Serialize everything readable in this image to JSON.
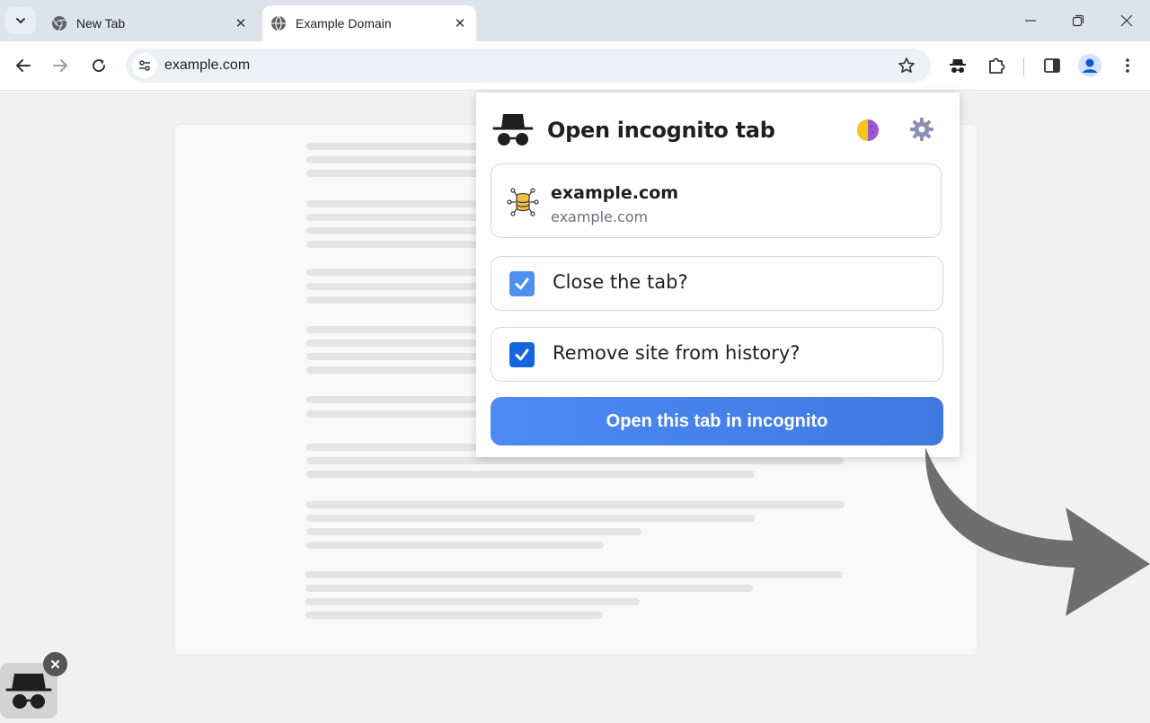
{
  "browser": {
    "tabs": [
      {
        "title": "New Tab",
        "favicon": "chrome-icon",
        "active": false
      },
      {
        "title": "Example Domain",
        "favicon": "globe-icon",
        "active": true
      }
    ],
    "address_bar": {
      "url": "example.com"
    }
  },
  "popup": {
    "title": "Open incognito tab",
    "site": {
      "name": "example.com",
      "url": "example.com"
    },
    "options": [
      {
        "label": "Close the tab?",
        "checked": true
      },
      {
        "label": "Remove site from history?",
        "checked": true
      }
    ],
    "cta_label": "Open this tab in incognito"
  },
  "colors": {
    "accent": "#3d7ae4",
    "checkbox_light": "#4f8ff0",
    "checkbox_dark": "#1565e0",
    "arrow": "#6e6e6e"
  }
}
